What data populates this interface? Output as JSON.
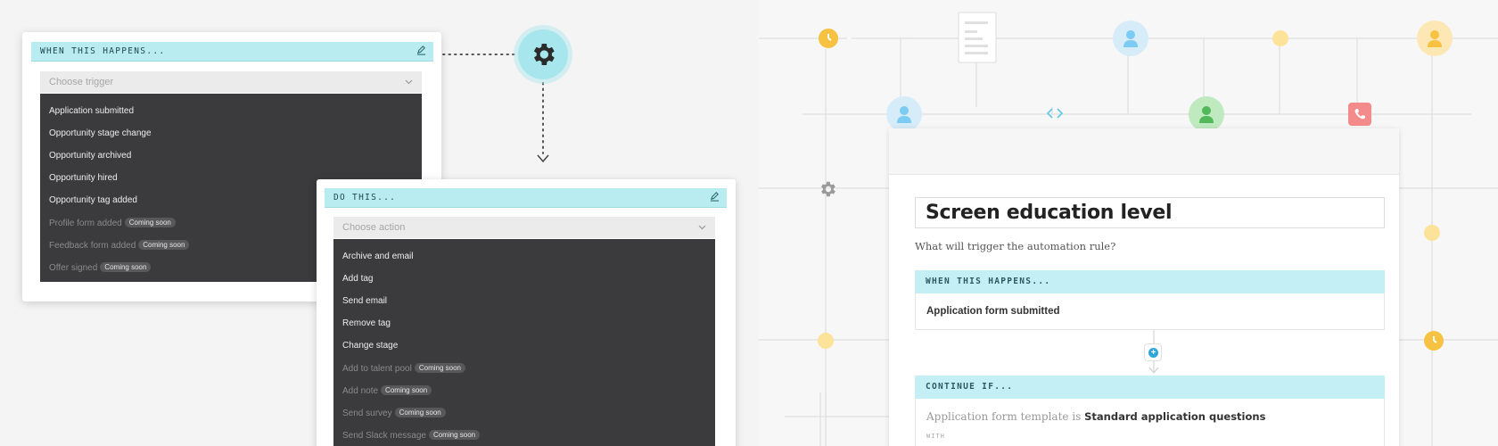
{
  "trigger_card": {
    "header": "WHEN THIS HAPPENS...",
    "placeholder": "Choose trigger",
    "options": [
      {
        "label": "Application submitted"
      },
      {
        "label": "Opportunity stage change"
      },
      {
        "label": "Opportunity archived"
      },
      {
        "label": "Opportunity hired"
      },
      {
        "label": "Opportunity tag added"
      },
      {
        "label": "Profile form added",
        "badge": "Coming soon"
      },
      {
        "label": "Feedback form added",
        "badge": "Coming soon"
      },
      {
        "label": "Offer signed",
        "badge": "Coming soon"
      }
    ]
  },
  "action_card": {
    "header": "DO THIS...",
    "placeholder": "Choose action",
    "options": [
      {
        "label": "Archive and email"
      },
      {
        "label": "Add tag"
      },
      {
        "label": "Send email"
      },
      {
        "label": "Remove tag"
      },
      {
        "label": "Change stage"
      },
      {
        "label": "Add to talent pool",
        "badge": "Coming soon"
      },
      {
        "label": "Add note",
        "badge": "Coming soon"
      },
      {
        "label": "Send survey",
        "badge": "Coming soon"
      },
      {
        "label": "Send Slack message",
        "badge": "Coming soon"
      }
    ]
  },
  "rule_editor": {
    "title": "Screen education level",
    "question": "What will trigger the automation rule?",
    "trigger_section": {
      "header": "WHEN THIS HAPPENS...",
      "value": "Application form submitted"
    },
    "condition_section": {
      "header": "CONTINUE IF...",
      "prefix": "Application form template is ",
      "value": "Standard application questions",
      "with_label": "WITH"
    }
  },
  "colors": {
    "accent_cyan": "#b9ecf1",
    "dropdown_bg": "#3b3b3d",
    "clock_yellow": "#f7c142",
    "dot_yellow": "#fde39a",
    "person_blue": "#7ccbf2",
    "person_green": "#52b85a",
    "phone_pink": "#f48b8b",
    "add_blue": "#2ea8dc"
  },
  "icons": [
    "edit-icon",
    "chevron-down-icon",
    "gear-icon",
    "clock-icon",
    "person-icon",
    "document-icon",
    "code-icon",
    "phone-icon",
    "plus-icon"
  ]
}
